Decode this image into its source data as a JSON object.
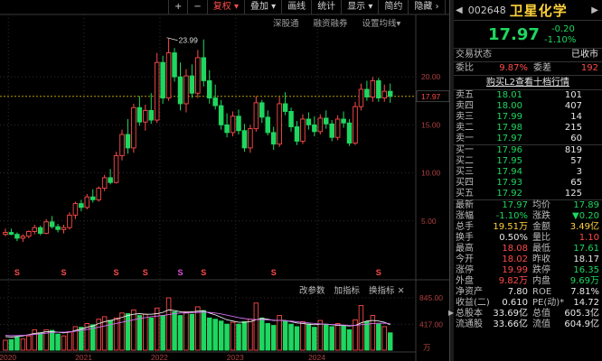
{
  "toolbar": {
    "items": [
      "+",
      "−",
      "复权",
      "叠加",
      "画线",
      "统计",
      "显示",
      "简约",
      "隐藏"
    ]
  },
  "subtools": [
    "深股通",
    "融资融券",
    "设置均线"
  ],
  "indicator_tools": [
    "改参数",
    "加指标",
    "换指标"
  ],
  "main_chart": {
    "price_axis": [
      "20.00",
      "15.00",
      "10.00",
      "5.00"
    ],
    "current_price_label": "17.97",
    "high_annotation": "23.99",
    "years": [
      "2020",
      "2021",
      "2022",
      "2023",
      "2024"
    ],
    "volume_axis": [
      "845.00",
      "417.00",
      "万"
    ]
  },
  "chart_data": {
    "type": "candlestick",
    "period": "monthly",
    "price_ylim": [
      1.5,
      26.5
    ],
    "reference_price": 17.97,
    "candles": [
      [
        3.6,
        4.2,
        3.4,
        3.8
      ],
      [
        3.8,
        4.2,
        3.5,
        3.6
      ],
      [
        3.6,
        3.8,
        2.9,
        3.2
      ],
      [
        3.2,
        3.6,
        2.8,
        3.4
      ],
      [
        3.4,
        4.0,
        3.2,
        3.9
      ],
      [
        3.9,
        4.6,
        3.6,
        4.3
      ],
      [
        4.3,
        4.5,
        3.5,
        3.7
      ],
      [
        3.7,
        5.2,
        3.6,
        4.9
      ],
      [
        4.9,
        5.5,
        4.2,
        4.4
      ],
      [
        4.4,
        4.7,
        3.8,
        4.1
      ],
      [
        4.1,
        4.6,
        3.7,
        4.3
      ],
      [
        4.3,
        5.9,
        4.1,
        5.6
      ],
      [
        5.6,
        7.0,
        5.2,
        6.8
      ],
      [
        6.8,
        7.2,
        6.0,
        6.4
      ],
      [
        6.4,
        7.8,
        6.2,
        7.5
      ],
      [
        7.5,
        8.3,
        6.9,
        7.2
      ],
      [
        7.2,
        8.6,
        7.0,
        8.4
      ],
      [
        8.4,
        9.8,
        8.1,
        9.5
      ],
      [
        9.5,
        10.4,
        8.8,
        9.0
      ],
      [
        9.0,
        12.2,
        8.9,
        11.8
      ],
      [
        11.8,
        14.5,
        11.3,
        14.0
      ],
      [
        14.0,
        15.6,
        12.0,
        12.6
      ],
      [
        12.6,
        17.2,
        12.1,
        16.8
      ],
      [
        16.8,
        18.0,
        14.9,
        15.3
      ],
      [
        15.3,
        17.1,
        14.4,
        16.5
      ],
      [
        16.5,
        18.3,
        15.1,
        15.5
      ],
      [
        15.5,
        22.5,
        15.2,
        21.5
      ],
      [
        21.5,
        22.2,
        17.2,
        17.8
      ],
      [
        17.8,
        23.99,
        17.5,
        22.5
      ],
      [
        22.5,
        23.0,
        19.5,
        20.0
      ],
      [
        20.0,
        21.5,
        16.5,
        17.2
      ],
      [
        17.2,
        20.8,
        16.3,
        20.1
      ],
      [
        20.1,
        21.3,
        17.8,
        18.3
      ],
      [
        18.3,
        22.8,
        17.8,
        22.0
      ],
      [
        22.0,
        23.9,
        19.0,
        19.6
      ],
      [
        19.6,
        20.7,
        17.2,
        17.8
      ],
      [
        17.8,
        19.2,
        16.6,
        17.0
      ],
      [
        17.0,
        17.6,
        14.5,
        15.0
      ],
      [
        15.0,
        16.2,
        13.7,
        14.2
      ],
      [
        14.2,
        16.4,
        13.8,
        15.9
      ],
      [
        15.9,
        16.6,
        14.0,
        14.4
      ],
      [
        14.4,
        15.1,
        12.2,
        12.6
      ],
      [
        12.6,
        15.0,
        12.1,
        14.6
      ],
      [
        14.6,
        18.0,
        14.3,
        17.3
      ],
      [
        17.3,
        17.6,
        15.2,
        15.8
      ],
      [
        15.8,
        16.5,
        13.9,
        14.2
      ],
      [
        14.2,
        14.8,
        12.4,
        13.0
      ],
      [
        13.0,
        17.9,
        12.7,
        17.2
      ],
      [
        17.2,
        18.4,
        16.0,
        16.4
      ],
      [
        16.4,
        16.8,
        14.3,
        14.8
      ],
      [
        14.8,
        15.4,
        12.9,
        13.3
      ],
      [
        13.3,
        16.1,
        13.0,
        15.6
      ],
      [
        15.6,
        16.3,
        14.5,
        15.0
      ],
      [
        15.0,
        15.9,
        13.8,
        14.3
      ],
      [
        14.3,
        16.1,
        14.0,
        15.7
      ],
      [
        15.7,
        16.5,
        14.6,
        15.1
      ],
      [
        15.1,
        15.5,
        13.3,
        13.7
      ],
      [
        13.7,
        16.0,
        13.4,
        15.6
      ],
      [
        15.6,
        16.4,
        14.7,
        15.2
      ],
      [
        15.2,
        15.6,
        12.8,
        13.1
      ],
      [
        13.1,
        17.4,
        12.9,
        16.9
      ],
      [
        16.9,
        19.3,
        16.5,
        18.7
      ],
      [
        18.7,
        19.6,
        17.5,
        17.9
      ],
      [
        17.9,
        20.0,
        17.4,
        19.6
      ],
      [
        19.6,
        19.9,
        17.4,
        17.8
      ],
      [
        17.8,
        19.2,
        17.4,
        18.5
      ],
      [
        18.5,
        19.3,
        17.3,
        17.97
      ]
    ],
    "volume_ylim": [
      0,
      845
    ],
    "volume": [
      160,
      170,
      210,
      180,
      230,
      330,
      280,
      330,
      320,
      260,
      230,
      300,
      380,
      370,
      430,
      410,
      500,
      540,
      480,
      520,
      600,
      590,
      650,
      560,
      580,
      520,
      680,
      560,
      845,
      620,
      560,
      620,
      580,
      700,
      640,
      520,
      500,
      470,
      420,
      450,
      420,
      460,
      500,
      760,
      520,
      430,
      400,
      560,
      470,
      420,
      380,
      460,
      420,
      370,
      480,
      410,
      380,
      430,
      400,
      330,
      490,
      720,
      460,
      560,
      420,
      380,
      280
    ],
    "ma1": [
      220,
      210,
      220,
      230,
      250,
      270,
      280,
      300,
      300,
      290,
      280,
      290,
      320,
      340,
      370,
      390,
      430,
      460,
      480,
      500,
      530,
      560,
      580,
      590,
      580,
      580,
      590,
      610,
      650,
      640,
      620,
      610,
      620,
      630,
      630,
      600,
      570,
      530,
      490,
      470,
      450,
      450,
      460,
      490,
      510,
      500,
      480,
      480,
      480,
      460,
      440,
      430,
      420,
      410,
      420,
      420,
      410,
      400,
      400,
      390,
      400,
      440,
      470,
      480,
      470,
      450,
      410
    ],
    "ma2": [
      240,
      235,
      235,
      240,
      245,
      255,
      265,
      275,
      285,
      290,
      290,
      295,
      305,
      320,
      335,
      350,
      370,
      390,
      410,
      430,
      450,
      470,
      490,
      510,
      525,
      540,
      550,
      560,
      575,
      590,
      600,
      600,
      605,
      610,
      615,
      610,
      600,
      585,
      565,
      545,
      525,
      510,
      500,
      495,
      495,
      490,
      485,
      480,
      475,
      470,
      460,
      450,
      440,
      430,
      425,
      420,
      415,
      410,
      405,
      400,
      400,
      410,
      420,
      430,
      435,
      435,
      430
    ],
    "dividend_markers": [
      {
        "i": 2,
        "c": "r"
      },
      {
        "i": 10,
        "c": "r"
      },
      {
        "i": 19,
        "c": "r"
      },
      {
        "i": 24,
        "c": "r"
      },
      {
        "i": 30,
        "c": "m"
      },
      {
        "i": 34,
        "c": "r"
      },
      {
        "i": 46,
        "c": "r"
      },
      {
        "i": 64,
        "c": "r"
      }
    ],
    "year_start_index": [
      1,
      14,
      27,
      40,
      54
    ]
  },
  "side": {
    "code": "002648",
    "name": "卫星化学",
    "price": "17.97",
    "change": "-0.20",
    "change_pct": "-1.10%",
    "status_label": "交易状态",
    "status_value": "已收市",
    "webi_label": "委比",
    "webi_value": "9.87%",
    "wecha_label": "委差",
    "wecha_value": "192",
    "l2_banner": "购买L2查看十档行情",
    "asks": [
      {
        "label": "卖五",
        "price": "18.01",
        "vol": "101"
      },
      {
        "label": "卖四",
        "price": "18.00",
        "vol": "407"
      },
      {
        "label": "卖三",
        "price": "17.99",
        "vol": "14"
      },
      {
        "label": "卖二",
        "price": "17.98",
        "vol": "215"
      },
      {
        "label": "卖一",
        "price": "17.97",
        "vol": "60"
      }
    ],
    "bids": [
      {
        "label": "买一",
        "price": "17.96",
        "vol": "819"
      },
      {
        "label": "买二",
        "price": "17.95",
        "vol": "57"
      },
      {
        "label": "买三",
        "price": "17.94",
        "vol": "3"
      },
      {
        "label": "买四",
        "price": "17.93",
        "vol": "65"
      },
      {
        "label": "买五",
        "price": "17.92",
        "vol": "125"
      }
    ],
    "stats": [
      {
        "l1": "最新",
        "v1": "17.97",
        "c1": "green",
        "l2": "均价",
        "v2": "17.89",
        "c2": "green"
      },
      {
        "l1": "涨幅",
        "v1": "-1.10%",
        "c1": "green",
        "l2": "涨跌",
        "v2": "▼0.20",
        "c2": "green"
      },
      {
        "l1": "总手",
        "v1": "19.51万",
        "c1": "yellow",
        "l2": "金额",
        "v2": "3.49亿",
        "c2": "yellow"
      },
      {
        "l1": "换手",
        "v1": "0.50%",
        "c1": "white",
        "l2": "量比",
        "v2": "1.10",
        "c2": "red"
      },
      {
        "l1": "最高",
        "v1": "18.08",
        "c1": "red",
        "l2": "最低",
        "v2": "17.61",
        "c2": "green"
      },
      {
        "l1": "今开",
        "v1": "18.02",
        "c1": "red",
        "l2": "昨收",
        "v2": "18.17",
        "c2": "white"
      },
      {
        "l1": "涨停",
        "v1": "19.99",
        "c1": "red",
        "l2": "跌停",
        "v2": "16.35",
        "c2": "green"
      },
      {
        "l1": "外盘",
        "v1": "9.82万",
        "c1": "red",
        "l2": "内盘",
        "v2": "9.69万",
        "c2": "green"
      },
      {
        "l1": "净资产",
        "v1": "7.80",
        "c1": "white",
        "l2": "ROE",
        "v2": "7.81%",
        "c2": "white"
      },
      {
        "l1": "收益(二)",
        "v1": "0.610",
        "c1": "white",
        "l2": "PE(动)*",
        "v2": "14.72",
        "c2": "white"
      },
      {
        "l1": "总股本",
        "v1": "33.69亿",
        "c1": "white",
        "l2": "总值",
        "v2": "605.3亿",
        "c2": "white"
      },
      {
        "l1": "流通股",
        "v1": "33.66亿",
        "c1": "white",
        "l2": "流值",
        "v2": "604.9亿",
        "c2": "white"
      }
    ]
  },
  "colors": {
    "up": "#ff4a4a",
    "down": "#1ed760",
    "ma1": "#f0f0f0",
    "ma2": "#d070f0",
    "ma3": "#f0c020",
    "ref": "#b8a000"
  }
}
